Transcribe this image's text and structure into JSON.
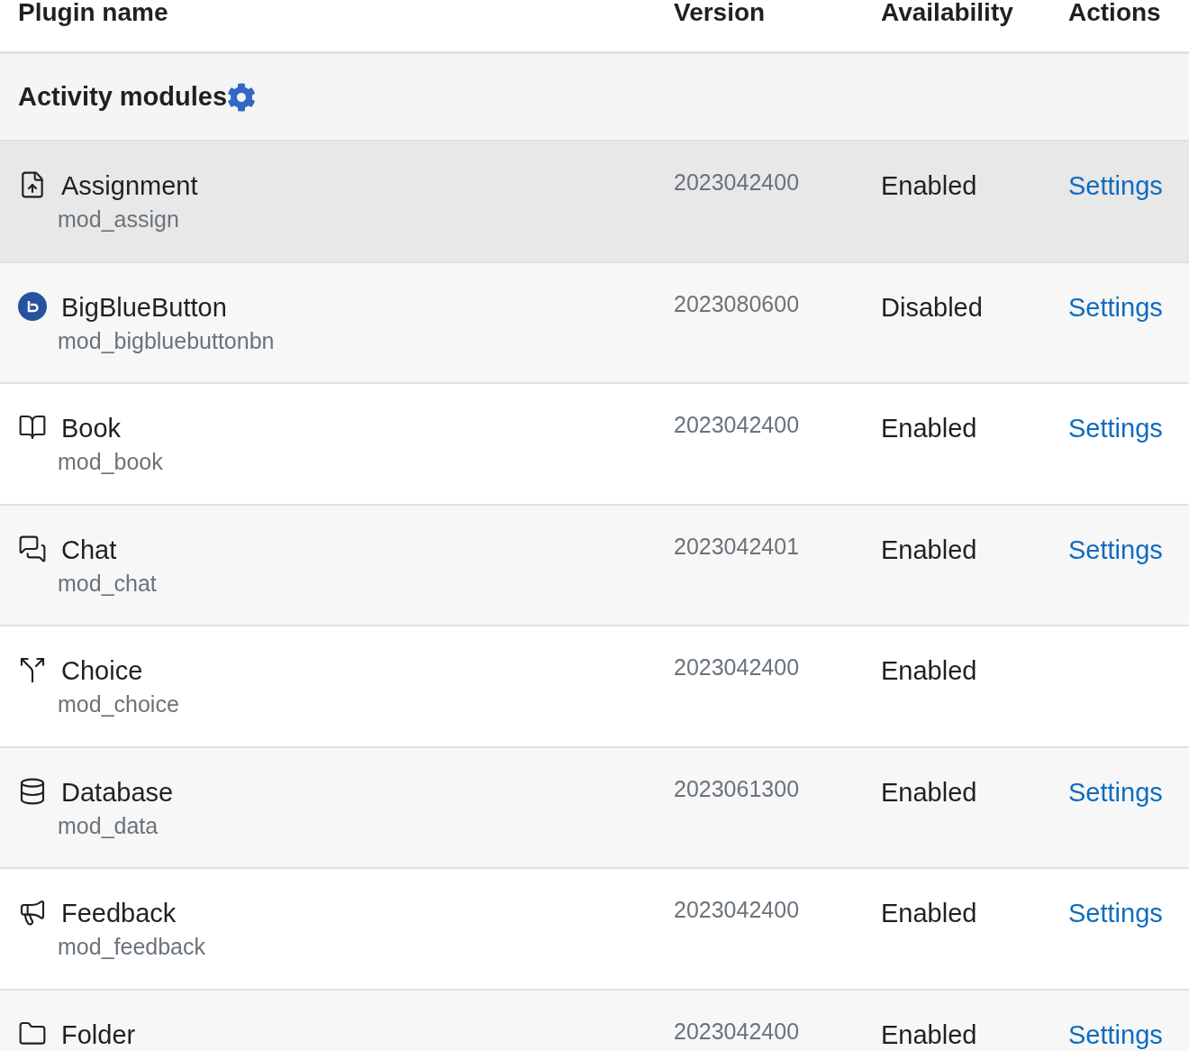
{
  "table": {
    "columns": [
      "Plugin name",
      "Version",
      "Availability",
      "Actions"
    ],
    "category": {
      "title": "Activity modules"
    },
    "rows": [
      {
        "kind": "assignment",
        "name": "Assignment",
        "component": "mod_assign",
        "version": "2023042400",
        "availability": "Enabled",
        "action": "Settings",
        "highlighted": true
      },
      {
        "kind": "bigbluebutton",
        "name": "BigBlueButton",
        "component": "mod_bigbluebuttonbn",
        "version": "2023080600",
        "availability": "Disabled",
        "action": "Settings",
        "highlighted": false
      },
      {
        "kind": "book",
        "name": "Book",
        "component": "mod_book",
        "version": "2023042400",
        "availability": "Enabled",
        "action": "Settings",
        "highlighted": false
      },
      {
        "kind": "chat",
        "name": "Chat",
        "component": "mod_chat",
        "version": "2023042401",
        "availability": "Enabled",
        "action": "Settings",
        "highlighted": false
      },
      {
        "kind": "choice",
        "name": "Choice",
        "component": "mod_choice",
        "version": "2023042400",
        "availability": "Enabled",
        "highlighted": false
      },
      {
        "kind": "database",
        "name": "Database",
        "component": "mod_data",
        "version": "2023061300",
        "availability": "Enabled",
        "action": "Settings",
        "highlighted": false
      },
      {
        "kind": "feedback",
        "name": "Feedback",
        "component": "mod_feedback",
        "version": "2023042400",
        "availability": "Enabled",
        "action": "Settings",
        "highlighted": false
      },
      {
        "kind": "folder",
        "name": "Folder",
        "version": "2023042400",
        "availability": "Enabled",
        "action": "Settings",
        "highlighted": false
      }
    ]
  }
}
